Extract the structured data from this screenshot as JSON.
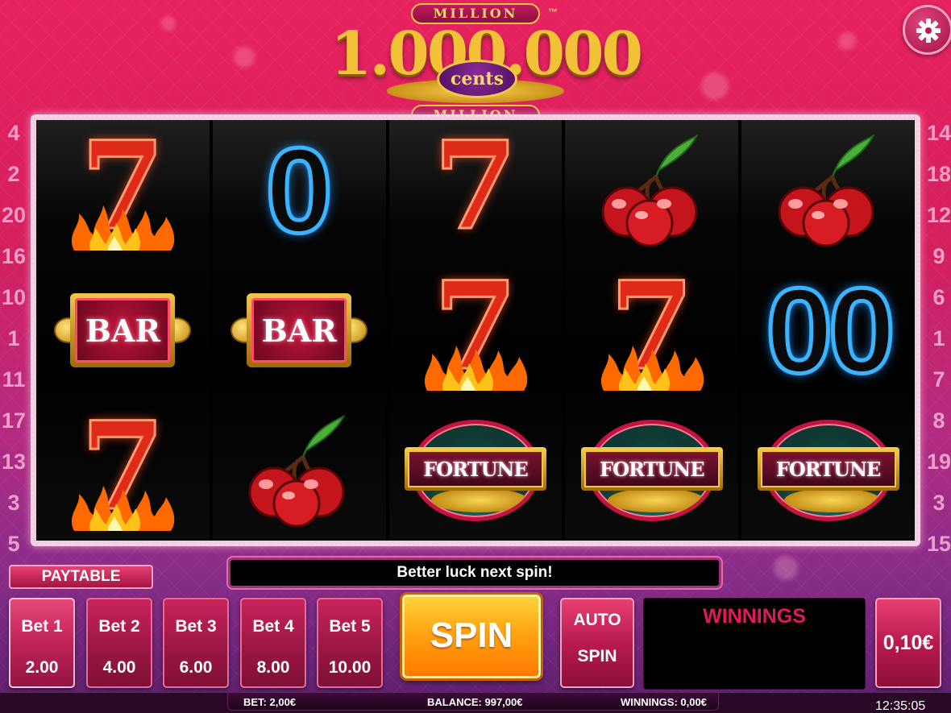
{
  "logo": {
    "top_text": "MILLION",
    "number": "1.000.000",
    "cents": "cents",
    "bottom_text": "MILLION",
    "trademark": "™"
  },
  "paylines": {
    "left": [
      "4",
      "2",
      "20",
      "16",
      "10",
      "1",
      "11",
      "17",
      "13",
      "3",
      "5"
    ],
    "right": [
      "14",
      "18",
      "12",
      "9",
      "6",
      "1",
      "7",
      "8",
      "19",
      "3",
      "15"
    ]
  },
  "reels": [
    [
      "seven-flame",
      "bar",
      "seven-flame"
    ],
    [
      "zero",
      "bar",
      "cherry"
    ],
    [
      "seven",
      "seven-flame",
      "fortune"
    ],
    [
      "cherry",
      "seven-flame",
      "fortune"
    ],
    [
      "cherry",
      "double-zero",
      "fortune"
    ]
  ],
  "symbols": {
    "seven": "7",
    "zero": "0",
    "double_zero": "00",
    "bar": "BAR",
    "fortune": "FORTUNE"
  },
  "controls": {
    "paytable": "PAYTABLE",
    "message": "Better luck next spin!",
    "bets": [
      {
        "label": "Bet 1",
        "value": "2.00"
      },
      {
        "label": "Bet 2",
        "value": "4.00"
      },
      {
        "label": "Bet 3",
        "value": "6.00"
      },
      {
        "label": "Bet 4",
        "value": "8.00"
      },
      {
        "label": "Bet 5",
        "value": "10.00"
      }
    ],
    "active_bet": "Bet 1",
    "spin": "SPIN",
    "auto_line1": "AUTO",
    "auto_line2": "SPIN",
    "winnings_label": "WINNINGS",
    "coin_value": "0,10€"
  },
  "status": {
    "bet": "BET: 2,00€",
    "balance": "BALANCE: 997,00€",
    "winnings": "WINNINGS: 0,00€",
    "clock": "12:35:05"
  },
  "colors": {
    "background": "#d41f5e",
    "spin_button": "#ffa412",
    "winnings_label": "#e0195e",
    "zero_glow": "#3ab4ff",
    "seven_red": "#e02a18"
  }
}
